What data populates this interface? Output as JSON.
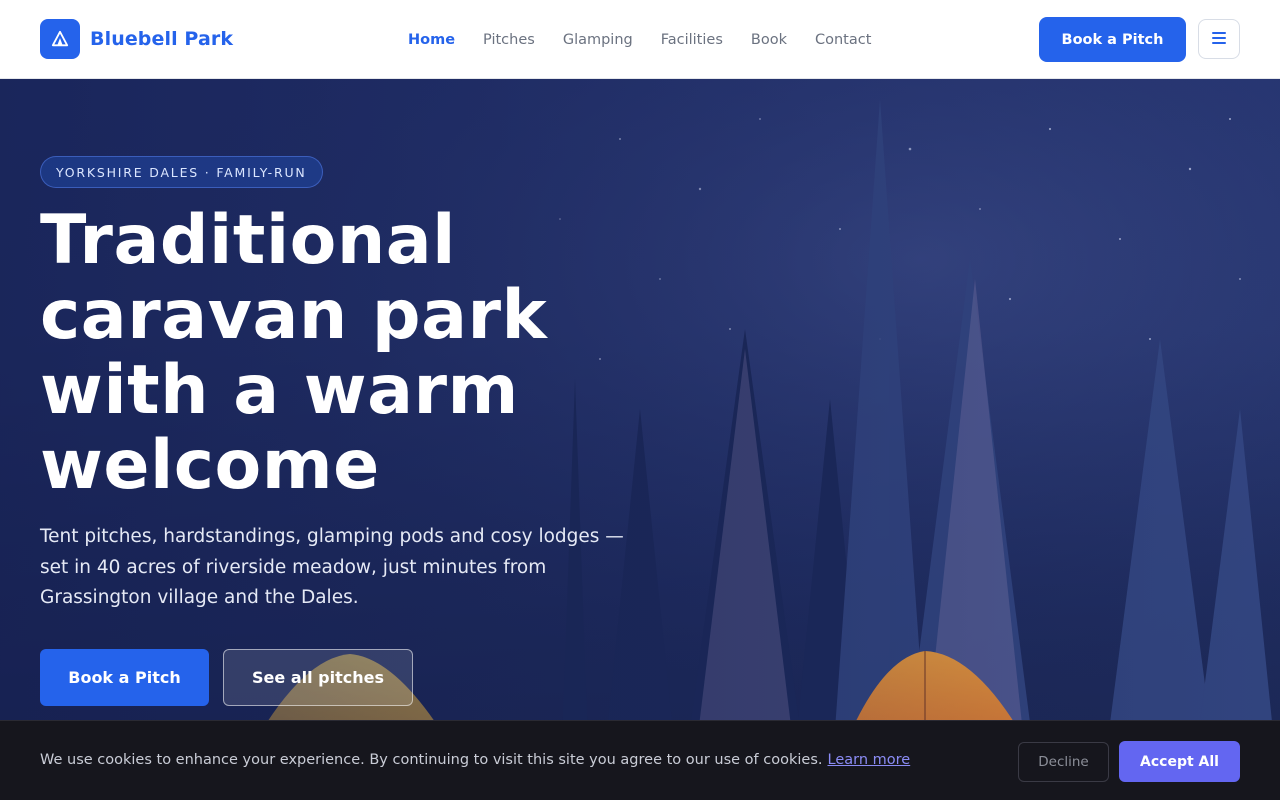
{
  "brand": {
    "name": "Bluebell Park",
    "icon": "tent-icon"
  },
  "nav": {
    "items": [
      {
        "label": "Home",
        "active": true
      },
      {
        "label": "Pitches",
        "active": false
      },
      {
        "label": "Glamping",
        "active": false
      },
      {
        "label": "Facilities",
        "active": false
      },
      {
        "label": "Book",
        "active": false
      },
      {
        "label": "Contact",
        "active": false
      }
    ]
  },
  "header": {
    "cta_label": "Book a Pitch",
    "menu_icon": "hamburger-icon"
  },
  "hero": {
    "badge": "YORKSHIRE DALES · FAMILY-RUN",
    "headline": "Traditional caravan park with a warm welcome",
    "subtext": "Tent pitches, hardstandings, glamping pods and cosy lodges — set in 40 acres of riverside meadow, just minutes from Grassington village and the Dales.",
    "primary_cta": "Book a Pitch",
    "secondary_cta": "See all pitches",
    "background": "night-sky-forest-tents"
  },
  "cookie_banner": {
    "text": "We use cookies to enhance your experience. By continuing to visit this site you agree to our use of cookies.",
    "link": "Learn more",
    "decline_label": "Decline",
    "accept_label": "Accept All"
  },
  "colors": {
    "primary": "#2563eb",
    "accent": "#6366f1",
    "cookie_bg": "#16161d",
    "hero_tint": "#253470"
  }
}
